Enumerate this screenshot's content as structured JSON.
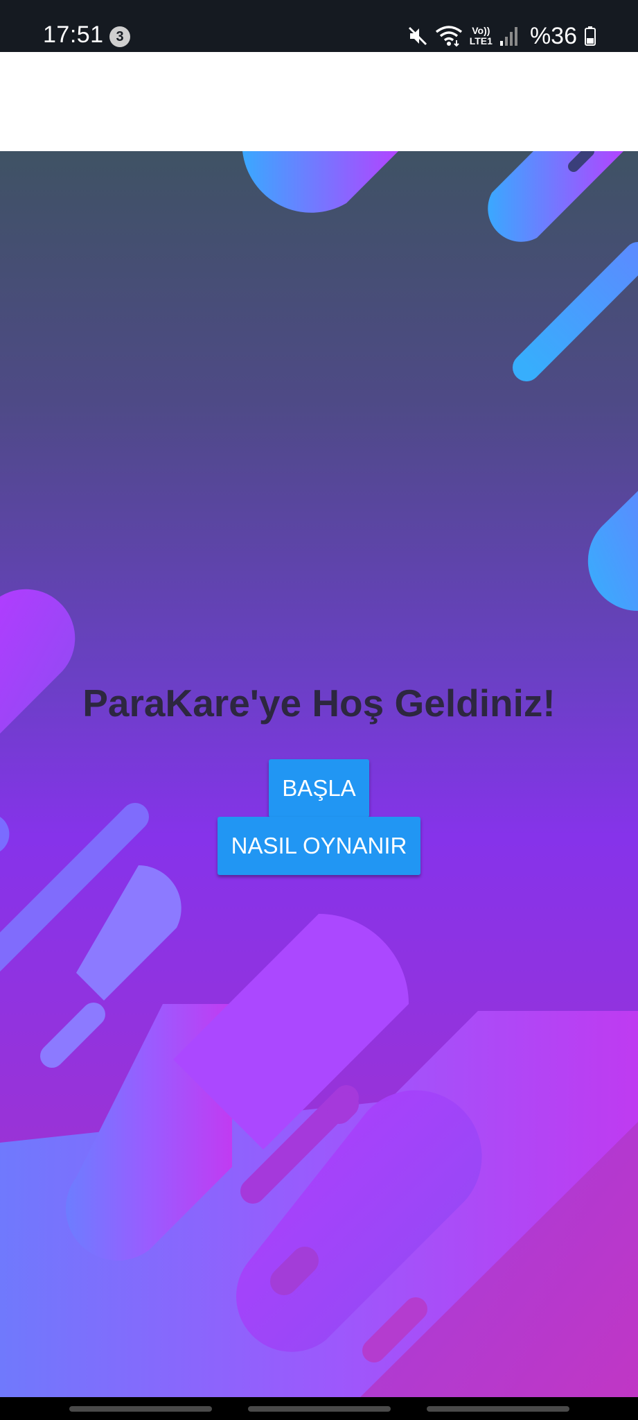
{
  "status_bar": {
    "time": "17:51",
    "notification_count": "3",
    "battery_percent": "%36",
    "icons": [
      "mute-icon",
      "wifi-icon",
      "volte-lte-icon",
      "signal-icon",
      "battery-icon"
    ],
    "network_label_top": "Vo))",
    "network_label_bottom": "LTE1"
  },
  "main": {
    "title": "ParaKare'ye Hoş Geldiniz!",
    "start_button": "BAŞLA",
    "how_to_play_button": "NASIL OYNANIR"
  },
  "colors": {
    "button": "#2196f3",
    "title_text": "#2d2740",
    "status_bar_bg": "#151a21",
    "gradient_top": "#3f5264",
    "gradient_mid": "#8633ea",
    "gradient_bottom": "#a831c9"
  }
}
